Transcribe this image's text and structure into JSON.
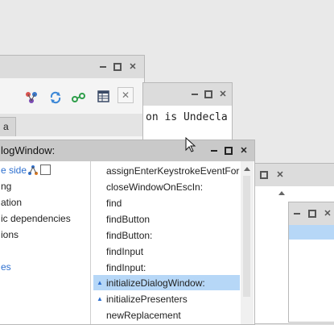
{
  "window_back": {
    "toolbar_close_label": "✕",
    "tab_label": "a"
  },
  "window_middle": {
    "text_line": "on is Undecla"
  },
  "window_front": {
    "title": "logWindow:",
    "tree_items": [
      "e side",
      "ng",
      "ation",
      "ic dependencies",
      "ions",
      "es"
    ],
    "methods": [
      "assignEnterKeystrokeEventFor",
      "closeWindowOnEscIn:",
      "find",
      "findButton",
      "findButton:",
      "findInput",
      "findInput:",
      "initializeDialogWindow:",
      "initializePresenters",
      "newReplacement"
    ],
    "selected_method": "initializeDialogWindow:",
    "selection_color": "#b6d7f7"
  }
}
